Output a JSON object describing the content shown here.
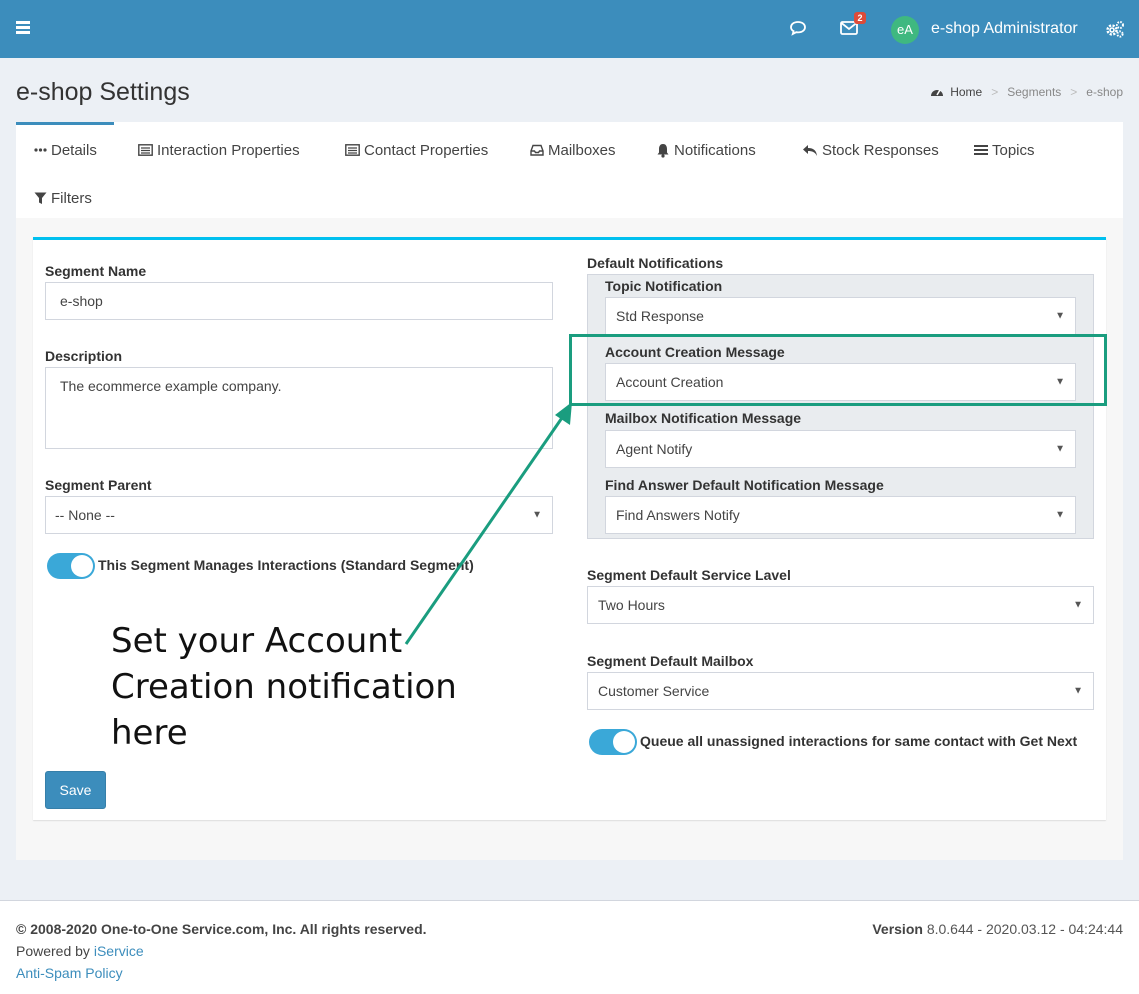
{
  "header": {
    "user_initials": "eA",
    "user_name": "e-shop Administrator",
    "mail_badge": "2",
    "icons": [
      "hamburger-icon",
      "chat-icon",
      "mail-icon",
      "gears-icon"
    ]
  },
  "page": {
    "title": "e-shop Settings",
    "breadcrumb": [
      "Home",
      "Segments",
      "e-shop"
    ]
  },
  "tabs": [
    {
      "label": "Details",
      "icon": "ellipsis-icon",
      "active": true
    },
    {
      "label": "Interaction Properties",
      "icon": "list-icon"
    },
    {
      "label": "Contact Properties",
      "icon": "list-icon"
    },
    {
      "label": "Mailboxes",
      "icon": "inbox-icon"
    },
    {
      "label": "Notifications",
      "icon": "bell-icon"
    },
    {
      "label": "Stock Responses",
      "icon": "reply-icon"
    },
    {
      "label": "Topics",
      "icon": "bars-icon"
    },
    {
      "label": "Filters",
      "icon": "filter-icon"
    }
  ],
  "form": {
    "segment_name_label": "Segment Name",
    "segment_name_value": "e-shop",
    "description_label": "Description",
    "description_value": "The ecommerce example company.",
    "segment_parent_label": "Segment Parent",
    "segment_parent_value": "-- None --",
    "manages_interactions_label": "This Segment Manages Interactions (Standard Segment)",
    "manages_interactions_on": true,
    "default_notifications_label": "Default Notifications",
    "topic_notification_label": "Topic Notification",
    "topic_notification_value": "Std Response",
    "account_creation_label": "Account Creation Message",
    "account_creation_value": "Account Creation",
    "mailbox_notification_label": "Mailbox Notification Message",
    "mailbox_notification_value": "Agent Notify",
    "find_answer_label": "Find Answer Default Notification Message",
    "find_answer_value": "Find Answers Notify",
    "service_level_label": "Segment Default Service Lavel",
    "service_level_value": "Two Hours",
    "default_mailbox_label": "Segment Default Mailbox",
    "default_mailbox_value": "Customer Service",
    "queue_label": "Queue all unassigned interactions for same contact with Get Next",
    "queue_on": true,
    "save_label": "Save"
  },
  "annotation": {
    "text": "Set your Account Creation notification here",
    "color": "#1a9d7f"
  },
  "footer": {
    "copyright": "© 2008-2020 One-to-One Service.com, Inc. All rights reserved.",
    "powered_prefix": "Powered by ",
    "powered_link": "iService",
    "antispam": "Anti-Spam Policy",
    "version_label": "Version",
    "version_value": "8.0.644 - 2020.03.12 - 04:24:44"
  }
}
